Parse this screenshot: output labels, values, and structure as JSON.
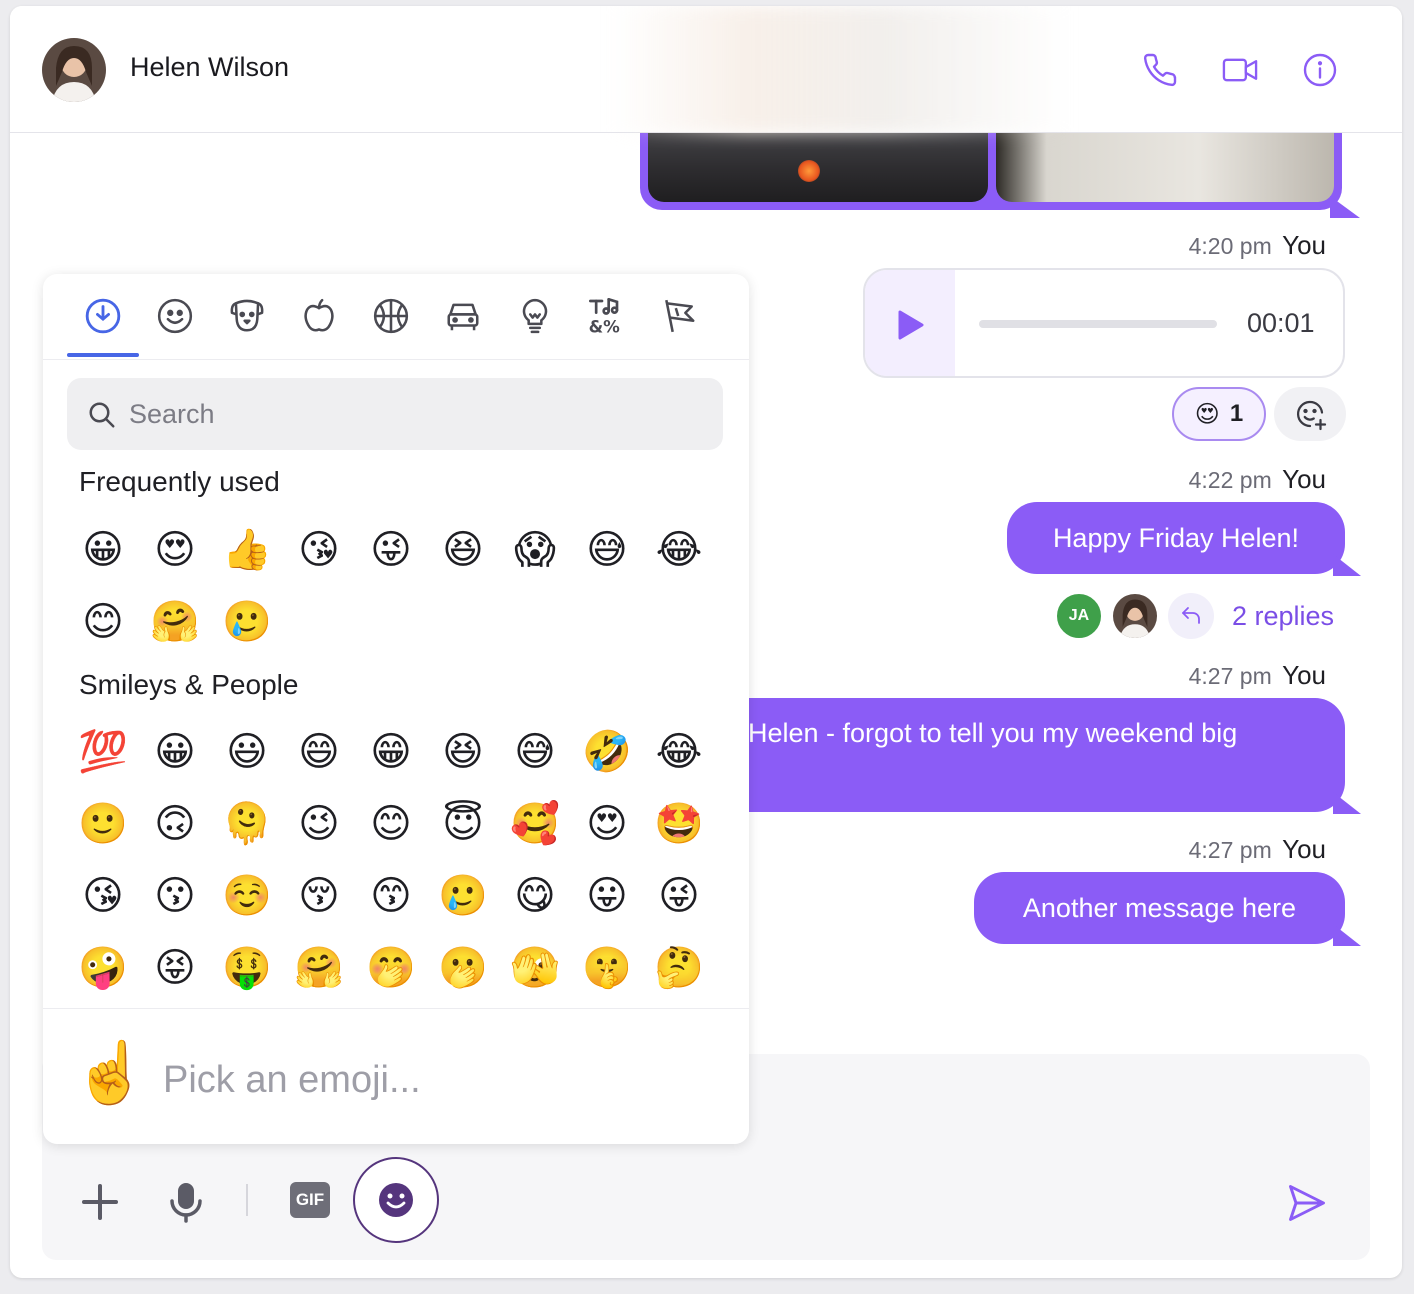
{
  "header": {
    "contact_name": "Helen Wilson",
    "icons": [
      "phone-icon",
      "video-icon",
      "info-icon"
    ]
  },
  "colors": {
    "accent": "#8b5cf6",
    "accent_text": "#7a4ee6",
    "picker_tab": "#4766e6",
    "avatar_ja": "#3fa04a"
  },
  "messages": {
    "voice": {
      "time": "4:20 pm",
      "sender": "You",
      "duration": "00:01",
      "reaction_emoji": "😍",
      "reaction_count": "1"
    },
    "m1": {
      "time": "4:22 pm",
      "sender": "You",
      "text": "Happy Friday Helen!",
      "replies_avatar_initials": "JA",
      "replies_label": "2 replies"
    },
    "m2": {
      "time": "4:27 pm",
      "sender": "You",
      "text": "Helen - forgot to tell you my weekend big"
    },
    "m3": {
      "time": "4:27 pm",
      "sender": "You",
      "text": "Another message here"
    }
  },
  "picker": {
    "categories": [
      "recent-icon",
      "smileys-icon",
      "animals-icon",
      "food-icon",
      "activity-icon",
      "travel-icon",
      "objects-icon",
      "symbols-icon",
      "flags-icon"
    ],
    "search_placeholder": "Search",
    "sections": [
      {
        "title": "Frequently used",
        "emojis": [
          "😀",
          "😍",
          "👍",
          "😘",
          "😜",
          "😆",
          "😱",
          "😅",
          "😂",
          "😊",
          "🤗",
          "🥲"
        ]
      },
      {
        "title": "Smileys & People",
        "emojis": [
          "💯",
          "😀",
          "😃",
          "😄",
          "😁",
          "😆",
          "😅",
          "🤣",
          "😂",
          "🙂",
          "🙃",
          "🫠",
          "😉",
          "😊",
          "😇",
          "🥰",
          "😍",
          "🤩",
          "😘",
          "😗",
          "☺️",
          "😚",
          "😙",
          "🥲",
          "😋",
          "😛",
          "😜",
          "🤪",
          "😝",
          "🤑",
          "🤗",
          "🤭",
          "🫢",
          "🫣",
          "🤫",
          "🤔"
        ]
      }
    ],
    "preview_emoji": "☝️",
    "preview_placeholder": "Pick an emoji..."
  },
  "composer": {
    "gif_label": "GIF",
    "icons": [
      "plus-icon",
      "microphone-icon",
      "gif-icon",
      "emoji-icon",
      "send-icon"
    ]
  }
}
